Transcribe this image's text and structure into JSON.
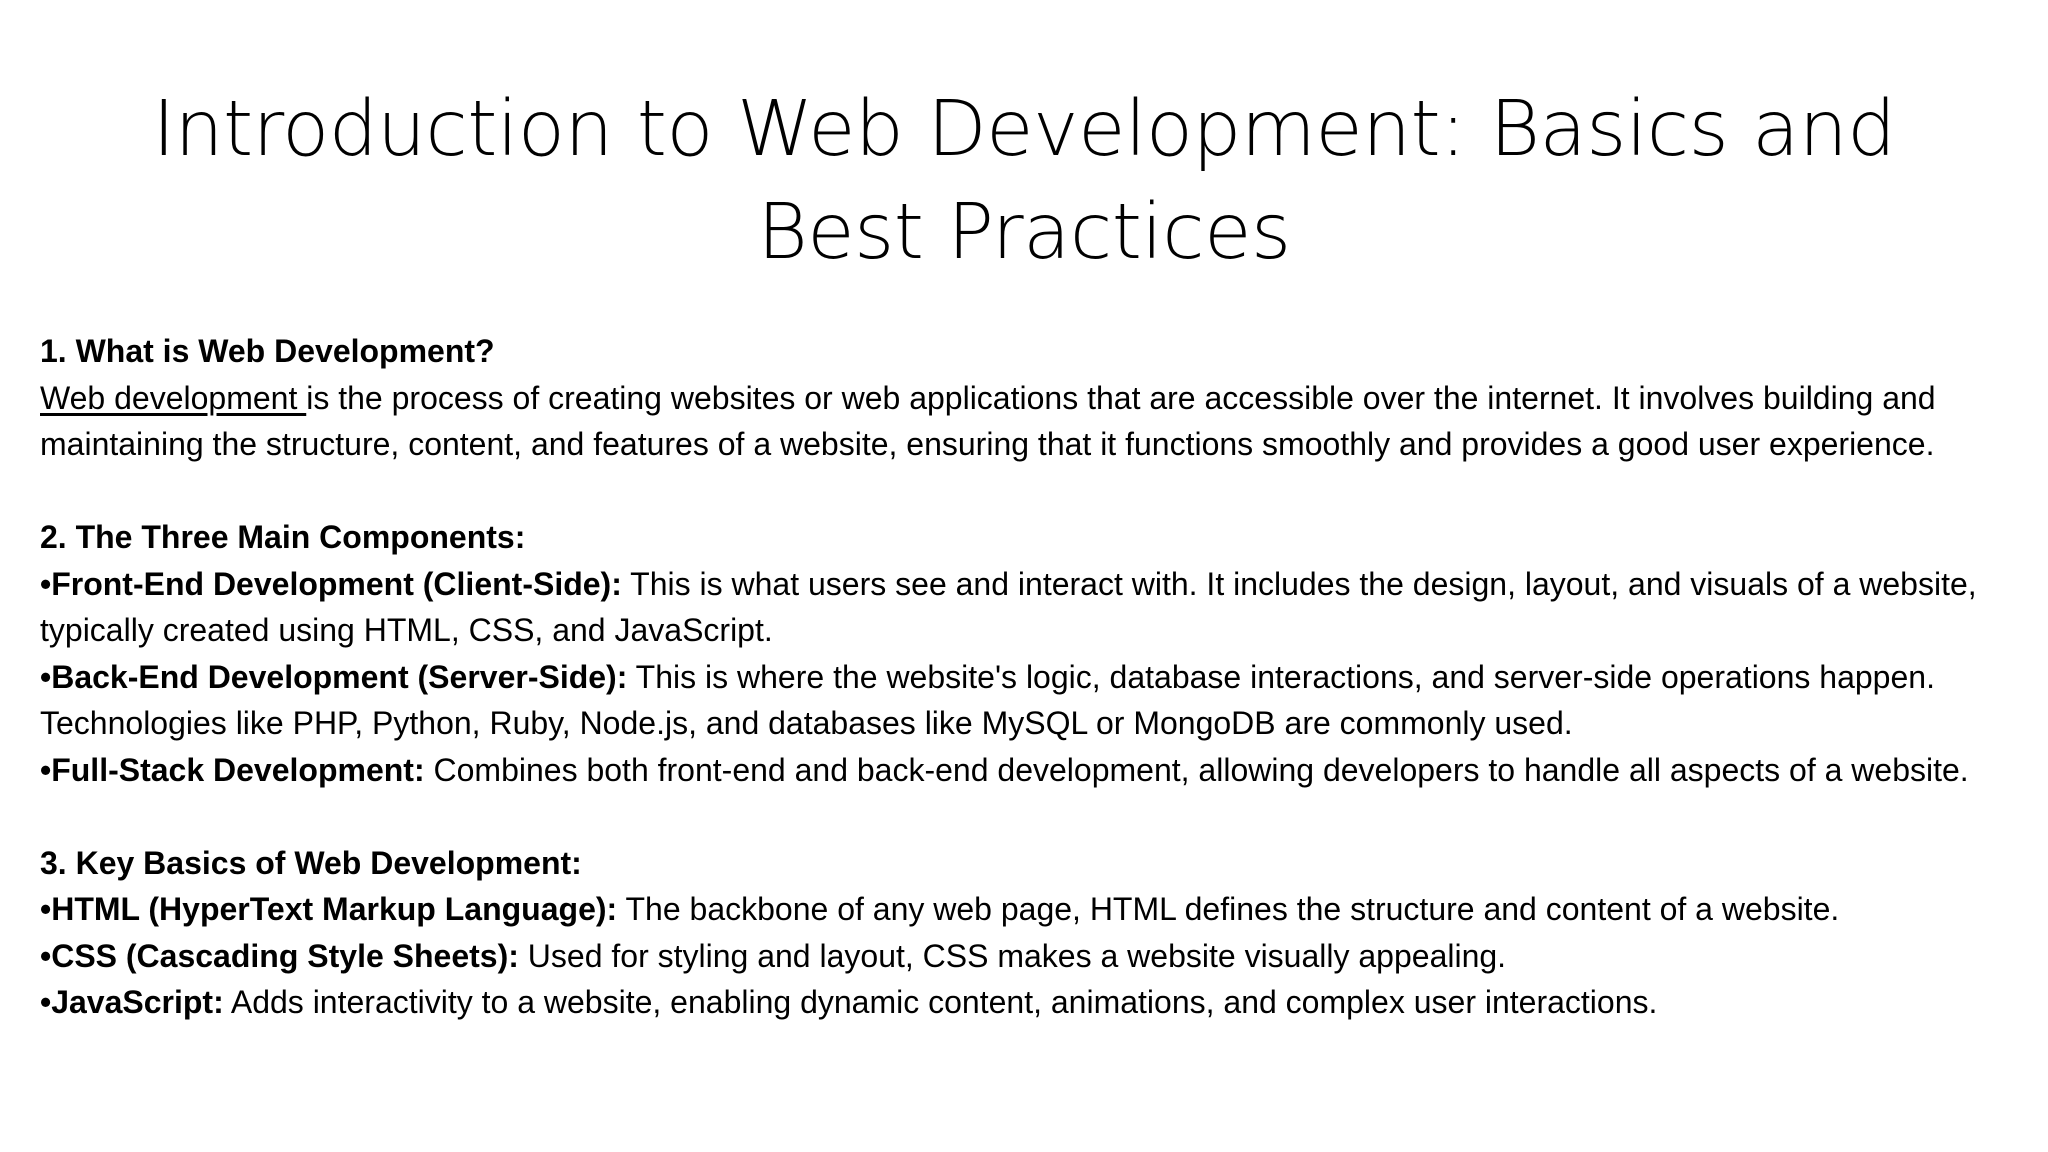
{
  "title": {
    "line1": "Introduction to Web Development: Basics and",
    "line2": "Best Practices"
  },
  "section1": {
    "heading": "1. What is Web Development?",
    "link_text": "Web development ",
    "text": "is the process of creating websites or web applications that are accessible over the internet. It involves building and maintaining the structure, content, and features of a website, ensuring that it functions smoothly and provides a good user experience."
  },
  "section2": {
    "heading": "2. The Three Main Components:",
    "bullets": [
      {
        "bullet": "•",
        "term": "Front-End Development (Client-Side):",
        "text": " This is what users see and interact with. It includes the design, layout, and visuals of a website, typically created using HTML, CSS, and JavaScript."
      },
      {
        "bullet": "•",
        "term": "Back-End Development (Server-Side):",
        "text": " This is where the website's logic, database interactions, and server-side operations happen. Technologies like PHP, Python, Ruby, Node.js, and databases like MySQL or MongoDB are commonly used."
      },
      {
        "bullet": "•",
        "term": "Full-Stack Development:",
        "text": " Combines both front-end and back-end development, allowing developers to handle all aspects of a website."
      }
    ]
  },
  "section3": {
    "heading": "3. Key Basics of Web Development:",
    "bullets": [
      {
        "bullet": "•",
        "term": "HTML (HyperText Markup Language):",
        "text": " The backbone of any web page, HTML defines the structure and content of a website."
      },
      {
        "bullet": "•",
        "term": "CSS (Cascading Style Sheets):",
        "text": " Used for styling and layout, CSS makes a website visually appealing."
      },
      {
        "bullet": "•",
        "term": "JavaScript:",
        "text": " Adds interactivity to a website, enabling dynamic content, animations, and complex user interactions."
      }
    ]
  }
}
